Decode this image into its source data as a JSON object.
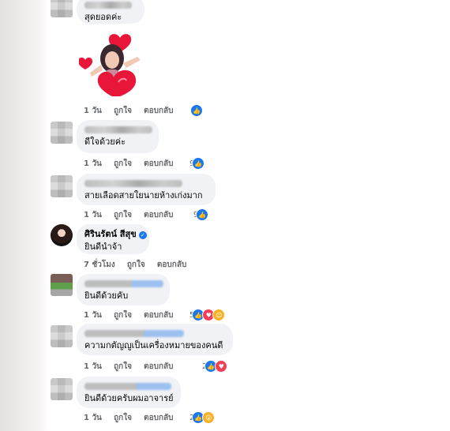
{
  "comments": [
    {
      "text": "สุดยอดค่ะ",
      "time": "1 วัน",
      "like": "ถูกใจ",
      "reply": "ตอบกลับ",
      "reaction_count": "",
      "has_sticker": true
    },
    {
      "text": "ดีใจด้วยค่ะ",
      "time": "1 วัน",
      "like": "ถูกใจ",
      "reply": "ตอบกลับ",
      "reaction_count": "9"
    },
    {
      "text": "สายเลือดสายใยนายห้างเก่งมาก",
      "time": "1 วัน",
      "like": "ถูกใจ",
      "reply": "ตอบกลับ",
      "reaction_count": "9"
    },
    {
      "author": "ศิรินรัตน์ สีสุข",
      "text": "ยินดีนำจ้า",
      "time": "7 ชั่วโมง",
      "like": "ถูกใจ",
      "reply": "ตอบกลับ",
      "verified": true
    },
    {
      "text": "ยินดีด้วยคับ",
      "time": "1 วัน",
      "like": "ถูกใจ",
      "reply": "ตอบกลับ",
      "reaction_count": "5"
    },
    {
      "text": "ความกตัญญูเป็นเครื่องหมายของคนดี",
      "time": "1 วัน",
      "like": "ถูกใจ",
      "reply": "ตอบกลับ",
      "reaction_count": "2"
    },
    {
      "text": "ยินดีด้วยครับผมอาจารย์",
      "time": "1 วัน",
      "like": "ถูกใจ",
      "reply": "ตอบกลับ",
      "reaction_count": "2"
    }
  ],
  "icons": {
    "like": "like-reaction-icon",
    "love": "love-reaction-icon",
    "haha": "haha-reaction-icon",
    "wow": "wow-reaction-icon",
    "verified": "verified-badge-icon"
  },
  "colors": {
    "like_blue": "#1877f2",
    "love_red": "#f33e58",
    "bubble_bg": "#f0f2f5",
    "meta_gray": "#65676b"
  }
}
